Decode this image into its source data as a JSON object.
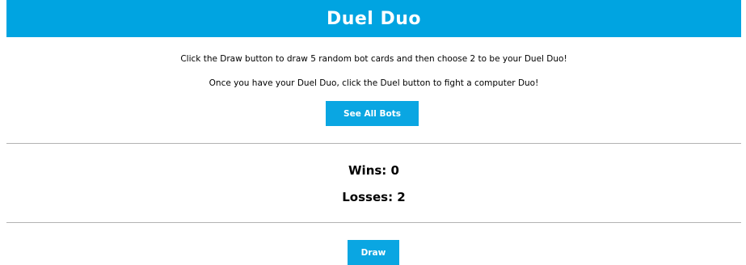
{
  "header": {
    "title": "Duel Duo"
  },
  "instructions": {
    "line1": "Click the Draw button to draw 5 random bot cards and then choose 2 to be your Duel Duo!",
    "line2": "Once you have your Duel Duo, click the Duel button to fight a computer Duo!"
  },
  "buttons": {
    "see_all_label": "See All Bots",
    "draw_label": "Draw"
  },
  "stats": {
    "wins_text": "Wins: 0",
    "losses_text": "Losses: 2"
  },
  "colors": {
    "accent": "#00a4e1",
    "divider": "#b3b3b3"
  }
}
